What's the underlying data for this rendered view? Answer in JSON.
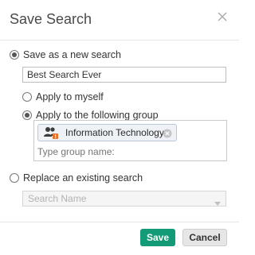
{
  "dialog": {
    "title": "Save Search"
  },
  "options": {
    "save_new_label": "Save as a new search",
    "search_name_value": "Best Search Ever",
    "apply_myself_label": "Apply to myself",
    "apply_group_label": "Apply to the following group",
    "group_chip_label": "Information Technology",
    "group_input_placeholder": "Type group name:",
    "replace_existing_label": "Replace an existing search",
    "search_select_placeholder": "Search Name"
  },
  "state": {
    "save_new_selected": true,
    "apply_to_group_selected": true
  },
  "buttons": {
    "save_label": "Save",
    "cancel_label": "Cancel"
  },
  "colors": {
    "save_button": "#129b76",
    "chip_bg": "#eef2f7",
    "warning_badge": "#e8742b"
  },
  "icons": {
    "close": "close-icon",
    "group": "group-icon",
    "chip_remove": "remove-icon",
    "select_caret": "chevron-down-icon"
  }
}
